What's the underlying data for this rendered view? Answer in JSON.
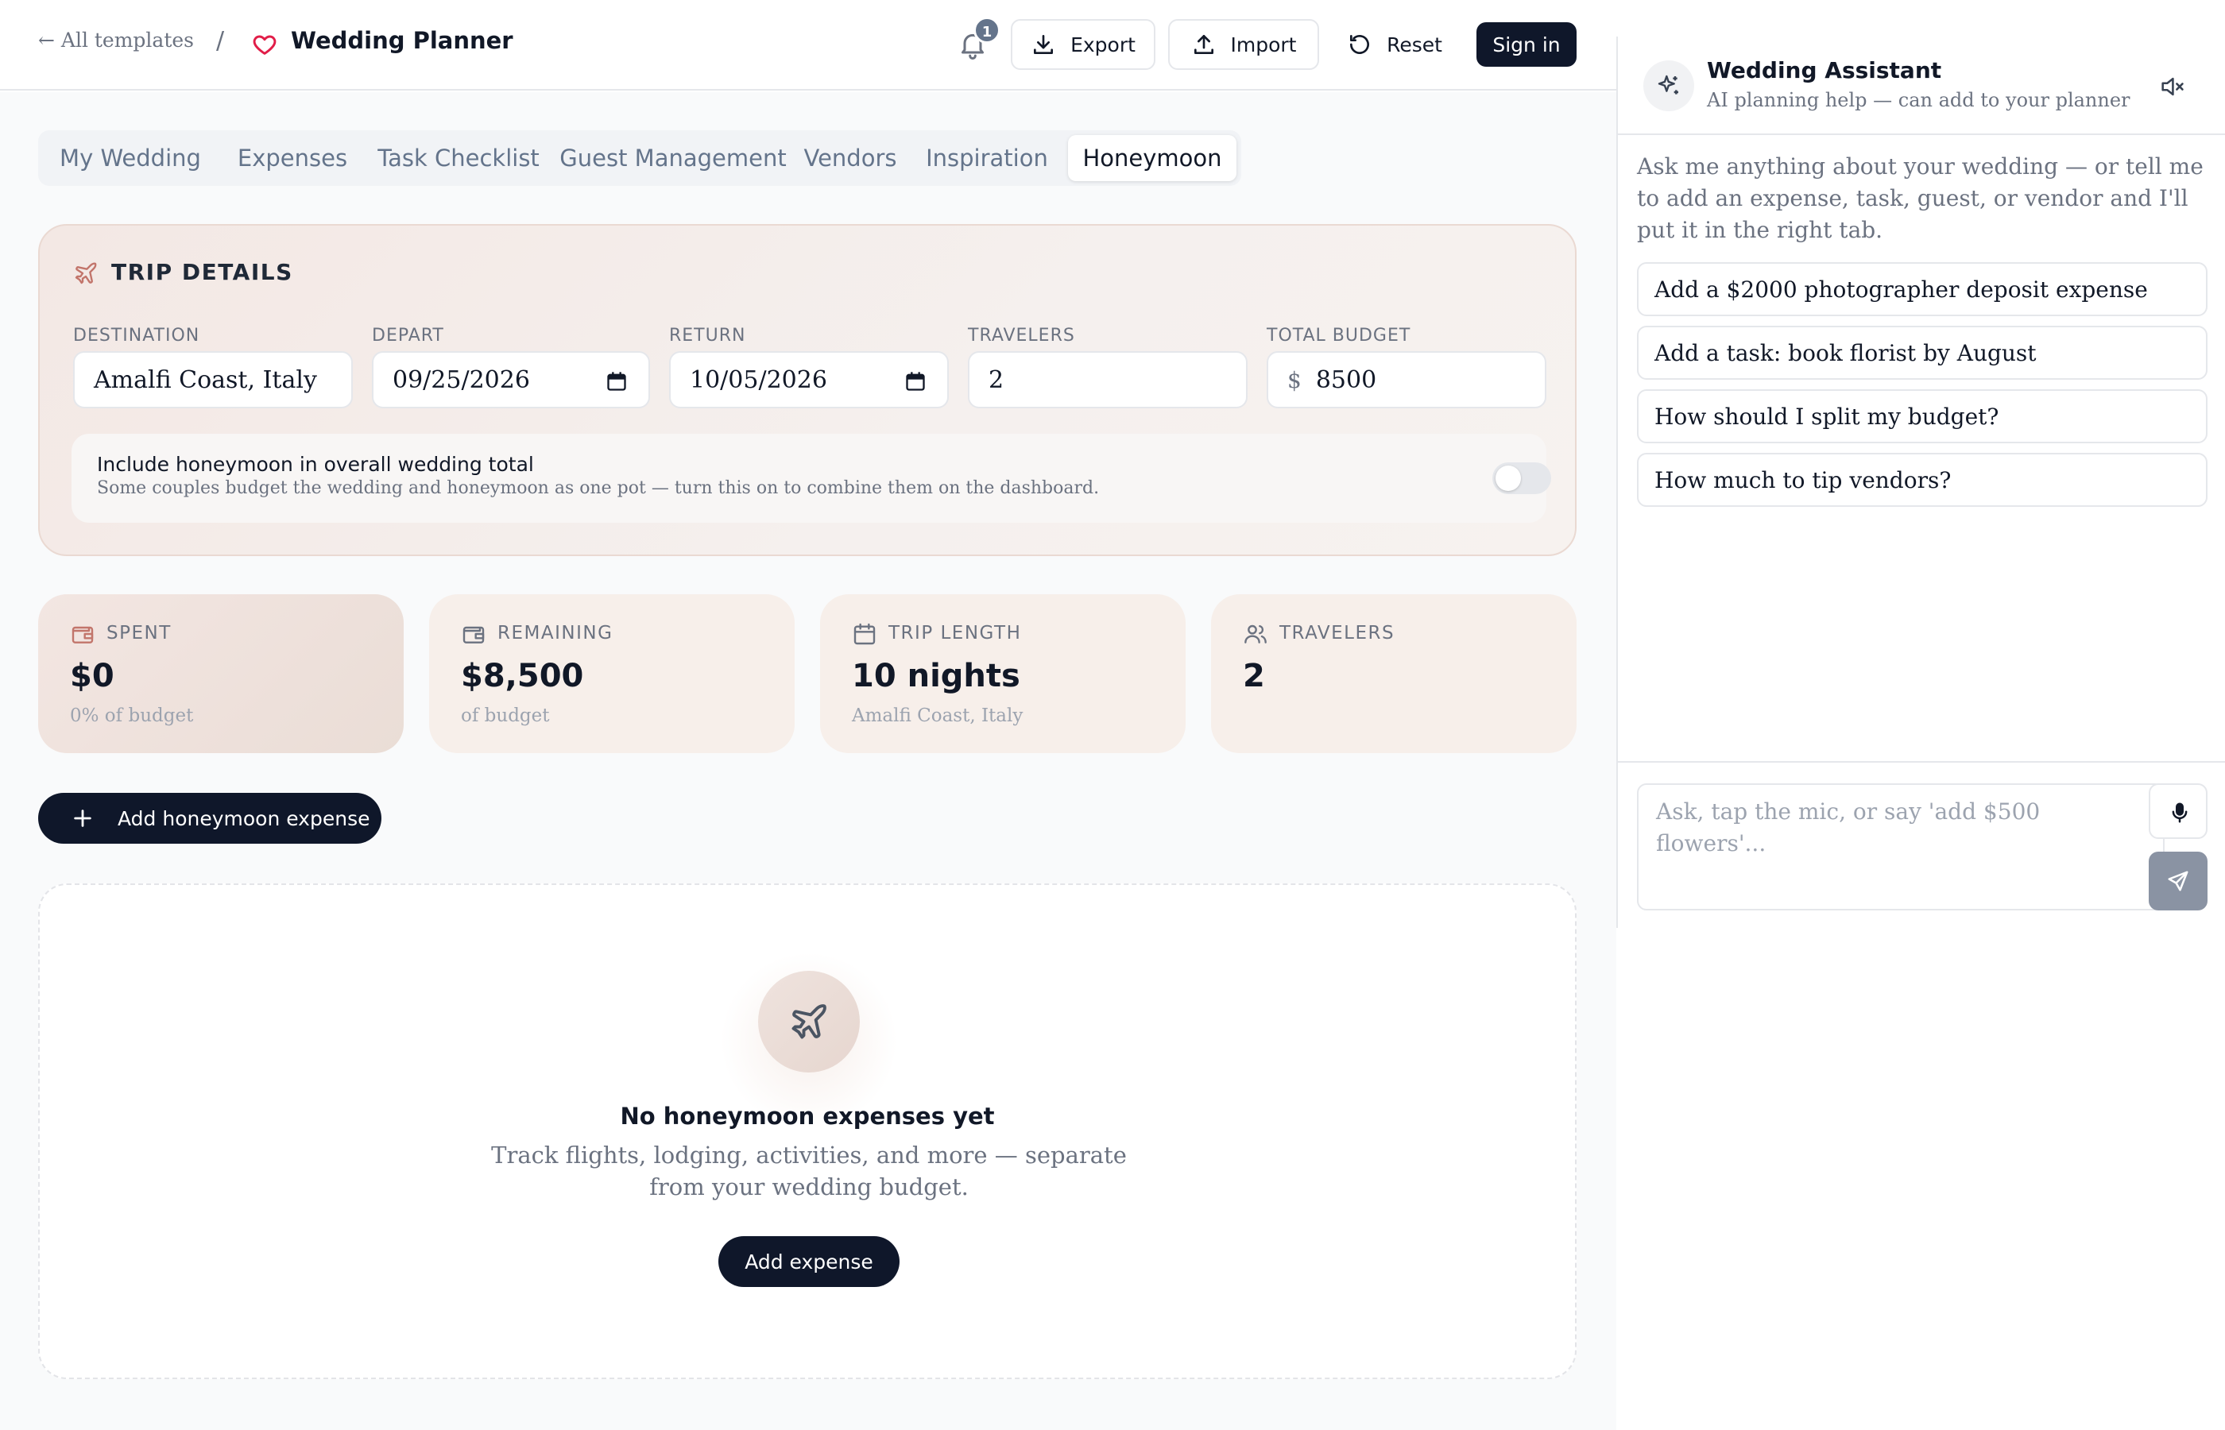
{
  "header": {
    "back_label": "← All templates",
    "separator": "/",
    "app_title": "Wedding Planner",
    "notification_count": "1",
    "export_label": "Export",
    "import_label": "Import",
    "reset_label": "Reset",
    "signin_label": "Sign in"
  },
  "tabs": [
    {
      "label": "My Wedding"
    },
    {
      "label": "Expenses"
    },
    {
      "label": "Task Checklist"
    },
    {
      "label": "Guest Management"
    },
    {
      "label": "Vendors"
    },
    {
      "label": "Inspiration"
    },
    {
      "label": "Honeymoon",
      "active": true
    }
  ],
  "trip": {
    "title": "TRIP DETAILS",
    "destination_label": "DESTINATION",
    "destination_value": "Amalfi Coast, Italy",
    "depart_label": "DEPART",
    "depart_value": "09/25/2026",
    "return_label": "RETURN",
    "return_value": "10/05/2026",
    "travelers_label": "TRAVELERS",
    "travelers_value": "2",
    "budget_label": "TOTAL BUDGET",
    "budget_currency": "$",
    "budget_value": "8500",
    "toggle_title": "Include honeymoon in overall wedding total",
    "toggle_sub": "Some couples budget the wedding and honeymoon as one pot — turn this on to combine them on the dashboard.",
    "toggle_on": false
  },
  "stats": [
    {
      "label": "SPENT",
      "value": "$0",
      "sub": "0% of budget",
      "icon": "wallet-icon"
    },
    {
      "label": "REMAINING",
      "value": "$8,500",
      "sub": "of budget",
      "icon": "wallet-icon"
    },
    {
      "label": "TRIP LENGTH",
      "value": "10 nights",
      "sub": "Amalfi Coast, Italy",
      "icon": "calendar-icon"
    },
    {
      "label": "TRAVELERS",
      "value": "2",
      "sub": "",
      "icon": "users-icon"
    }
  ],
  "add_expense_label": "Add honeymoon expense",
  "empty_state": {
    "title": "No honeymoon expenses yet",
    "subtitle": "Track flights, lodging, activities, and more — separate from your wedding budget.",
    "button_label": "Add expense"
  },
  "assistant": {
    "title": "Wedding Assistant",
    "subtitle": "AI planning help — can add to your planner",
    "intro": "Ask me anything about your wedding — or tell me to add an expense, task, guest, or vendor and I'll put it in the right tab.",
    "suggestions": [
      "Add a $2000 photographer deposit expense",
      "Add a task: book florist by August",
      "How should I split my budget?",
      "How much to tip vendors?"
    ],
    "input_placeholder": "Ask, tap the mic, or say 'add $500 flowers'..."
  },
  "colors": {
    "accent_dark": "#0f172a",
    "heart": "#e11d48",
    "plane": "#c2756b",
    "card_tint": "#f7efea"
  }
}
